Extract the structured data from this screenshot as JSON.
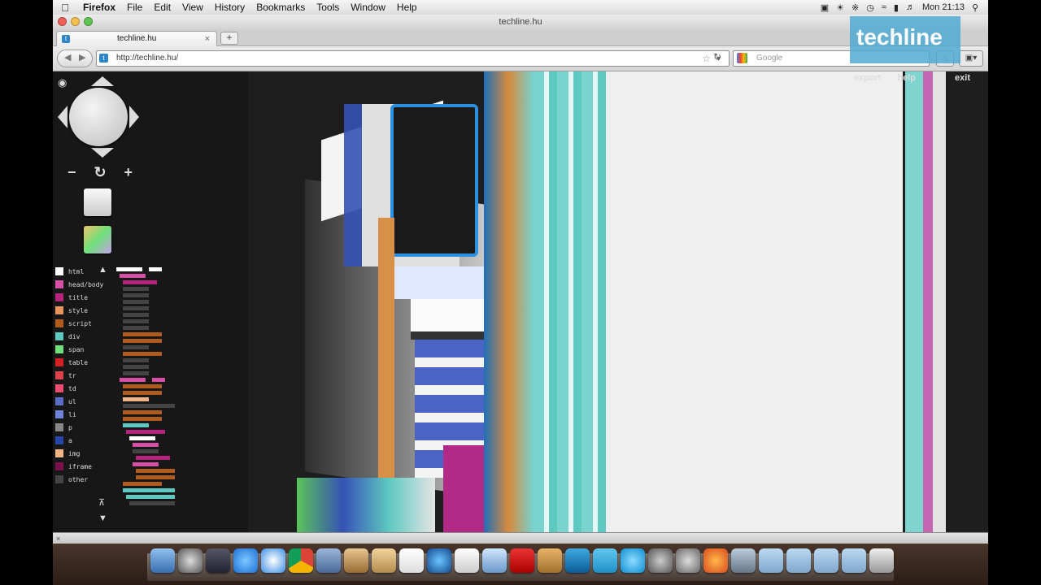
{
  "menubar": {
    "app": "Firefox",
    "items": [
      "File",
      "Edit",
      "View",
      "History",
      "Bookmarks",
      "Tools",
      "Window",
      "Help"
    ],
    "clock": "Mon 21:13"
  },
  "window": {
    "title": "techline.hu"
  },
  "tab": {
    "label": "techline.hu"
  },
  "urlbar": {
    "url": "http://techline.hu/"
  },
  "search": {
    "placeholder": "Google"
  },
  "watermark": {
    "text": "techline"
  },
  "tilt": {
    "links": {
      "export": "export",
      "help": "help",
      "exit": "exit"
    },
    "legend": [
      {
        "label": "html",
        "color": "#ffffff"
      },
      {
        "label": "head/body",
        "color": "#d64fa6"
      },
      {
        "label": "title",
        "color": "#b7227d"
      },
      {
        "label": "style",
        "color": "#e8945a"
      },
      {
        "label": "script",
        "color": "#b25a1e"
      },
      {
        "label": "div",
        "color": "#5ec9c1"
      },
      {
        "label": "span",
        "color": "#6fe07a"
      },
      {
        "label": "table",
        "color": "#d51f23"
      },
      {
        "label": "tr",
        "color": "#e0424c"
      },
      {
        "label": "td",
        "color": "#ea4d6f"
      },
      {
        "label": "ul",
        "color": "#5a6ec9"
      },
      {
        "label": "li",
        "color": "#6f83d8"
      },
      {
        "label": "p",
        "color": "#888888"
      },
      {
        "label": "a",
        "color": "#2646a8"
      },
      {
        "label": "img",
        "color": "#f2b484"
      },
      {
        "label": "iframe",
        "color": "#7a0f4c"
      },
      {
        "label": "other",
        "color": "#444444"
      }
    ]
  }
}
